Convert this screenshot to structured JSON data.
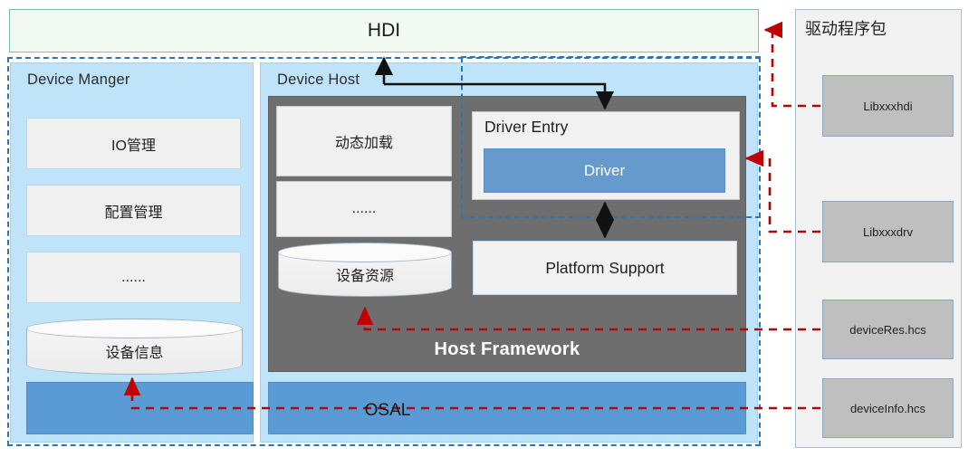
{
  "hdi": {
    "label": "HDI"
  },
  "device_manager": {
    "title": "Device Manger",
    "modules": [
      {
        "label": "IO管理",
        "shape": "box"
      },
      {
        "label": "配置管理",
        "shape": "box"
      },
      {
        "label": "......",
        "shape": "box"
      },
      {
        "label": "设备信息",
        "shape": "cylinder"
      }
    ]
  },
  "device_host": {
    "title": "Device Host",
    "host_framework": {
      "label": "Host Framework"
    },
    "left_stack": [
      {
        "label": "动态加载",
        "shape": "box"
      },
      {
        "label": "......",
        "shape": "box"
      },
      {
        "label": "设备资源",
        "shape": "cylinder"
      }
    ],
    "driver_entry": {
      "title": "Driver Entry",
      "driver_label": "Driver"
    },
    "platform_support": {
      "label": "Platform Support"
    }
  },
  "osal": {
    "label": "OSAL"
  },
  "driver_package": {
    "title": "驱动程序包",
    "items": [
      {
        "label": "Libxxxhdi"
      },
      {
        "label": "Libxxxdrv"
      },
      {
        "label": "deviceRes.hcs"
      },
      {
        "label": "deviceInfo.hcs"
      }
    ]
  },
  "colors": {
    "panel_blue": "#bfe4fa",
    "host_framework_gray": "#6e6e6e",
    "driver_blue": "#6699cc",
    "osal_blue": "#5b9bd5",
    "hdi_mint": "#f2f9f2",
    "dashed_blue": "#2e75b6",
    "dashed_red": "#c00000",
    "package_item_gray": "#bfbfbf"
  }
}
